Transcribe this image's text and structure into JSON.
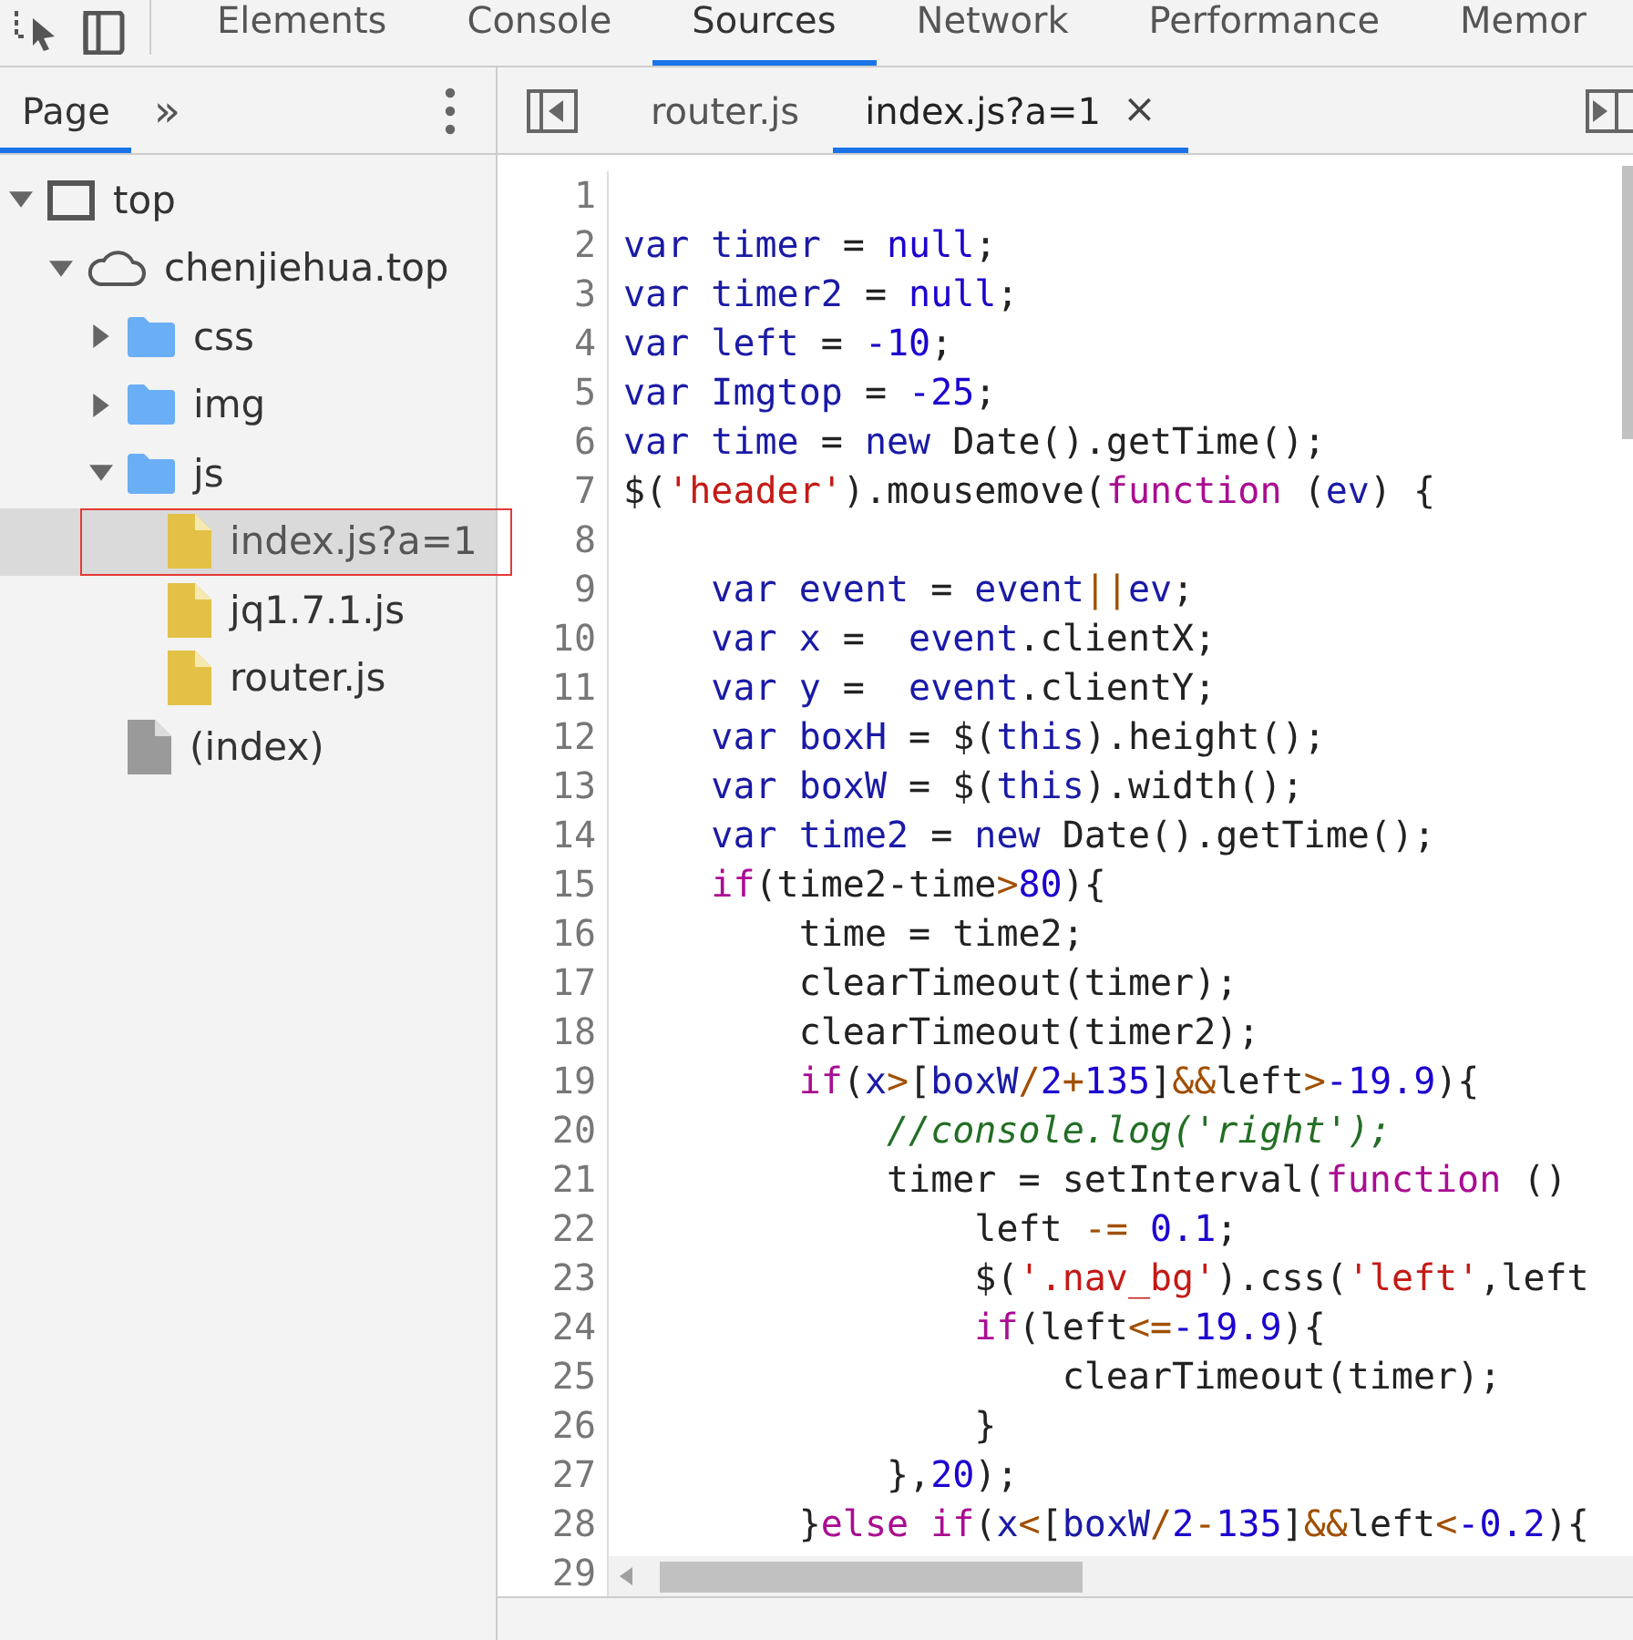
{
  "main_tabs": [
    {
      "label": "Elements",
      "selected": false
    },
    {
      "label": "Console",
      "selected": false
    },
    {
      "label": "Sources",
      "selected": true
    },
    {
      "label": "Network",
      "selected": false
    },
    {
      "label": "Performance",
      "selected": false
    },
    {
      "label": "Memor",
      "selected": false
    }
  ],
  "navigator": {
    "tabs": [
      {
        "label": "Page",
        "selected": true
      }
    ],
    "more": "»"
  },
  "tree": [
    {
      "label": "top",
      "kind": "frame",
      "expanded": true,
      "selected": false,
      "children": [
        {
          "label": "chenjiehua.top",
          "kind": "cloud",
          "expanded": true,
          "selected": false,
          "children": [
            {
              "label": "css",
              "kind": "folder",
              "expanded": false,
              "selected": false
            },
            {
              "label": "img",
              "kind": "folder",
              "expanded": false,
              "selected": false
            },
            {
              "label": "js",
              "kind": "folder",
              "expanded": true,
              "selected": false,
              "children": [
                {
                  "label": "index.js?a=1",
                  "kind": "script",
                  "selected": true,
                  "annotated": true
                },
                {
                  "label": "jq1.7.1.js",
                  "kind": "script",
                  "selected": false,
                  "annotated": false
                },
                {
                  "label": "router.js",
                  "kind": "script",
                  "selected": false,
                  "annotated": false
                }
              ]
            },
            {
              "label": "(index)",
              "kind": "document",
              "selected": false
            }
          ]
        }
      ]
    }
  ],
  "editor_tabs": [
    {
      "label": "router.js",
      "selected": false,
      "closable": false
    },
    {
      "label": "index.js?a=1",
      "selected": true,
      "closable": true,
      "close": "×"
    }
  ],
  "code": [
    {
      "n": "1"
    },
    {
      "n": "2",
      "t": [
        {
          "kind": "kw",
          "text": "var "
        },
        {
          "kind": "def",
          "text": "timer"
        },
        {
          "kind": "pl",
          "text": " = "
        },
        {
          "kind": "num",
          "text": "null"
        },
        {
          "kind": "pl",
          "text": ";"
        }
      ]
    },
    {
      "n": "3",
      "t": [
        {
          "kind": "kw",
          "text": "var "
        },
        {
          "kind": "def",
          "text": "timer2"
        },
        {
          "kind": "pl",
          "text": " = "
        },
        {
          "kind": "num",
          "text": "null"
        },
        {
          "kind": "pl",
          "text": ";"
        }
      ]
    },
    {
      "n": "4",
      "t": [
        {
          "kind": "kw",
          "text": "var "
        },
        {
          "kind": "def",
          "text": "left"
        },
        {
          "kind": "pl",
          "text": " = "
        },
        {
          "kind": "num",
          "text": "-10"
        },
        {
          "kind": "pl",
          "text": ";"
        }
      ]
    },
    {
      "n": "5",
      "t": [
        {
          "kind": "kw",
          "text": "var "
        },
        {
          "kind": "def",
          "text": "Imgtop"
        },
        {
          "kind": "pl",
          "text": " = "
        },
        {
          "kind": "num",
          "text": "-25"
        },
        {
          "kind": "pl",
          "text": ";"
        }
      ]
    },
    {
      "n": "6",
      "t": [
        {
          "kind": "kw",
          "text": "var "
        },
        {
          "kind": "def",
          "text": "time"
        },
        {
          "kind": "pl",
          "text": " = "
        },
        {
          "kind": "kw",
          "text": "new"
        },
        {
          "kind": "pl",
          "text": " Date().getTime();"
        }
      ]
    },
    {
      "n": "7",
      "t": [
        {
          "kind": "pl",
          "text": "$("
        },
        {
          "kind": "str",
          "text": "'header'"
        },
        {
          "kind": "pl",
          "text": ").mousemove("
        },
        {
          "kind": "kw2",
          "text": "function"
        },
        {
          "kind": "pl",
          "text": " ("
        },
        {
          "kind": "def",
          "text": "ev"
        },
        {
          "kind": "pl",
          "text": ") {"
        }
      ]
    },
    {
      "n": "8"
    },
    {
      "n": "9",
      "t": [
        {
          "kind": "kw",
          "text": "    var "
        },
        {
          "kind": "def",
          "text": "event"
        },
        {
          "kind": "pl",
          "text": " = "
        },
        {
          "kind": "def",
          "text": "event"
        },
        {
          "kind": "op",
          "text": "||"
        },
        {
          "kind": "def",
          "text": "ev"
        },
        {
          "kind": "pl",
          "text": ";"
        }
      ]
    },
    {
      "n": "10",
      "t": [
        {
          "kind": "kw",
          "text": "    var "
        },
        {
          "kind": "def",
          "text": "x"
        },
        {
          "kind": "pl",
          "text": " =  "
        },
        {
          "kind": "def",
          "text": "event"
        },
        {
          "kind": "pl",
          "text": ".clientX;"
        }
      ]
    },
    {
      "n": "11",
      "t": [
        {
          "kind": "kw",
          "text": "    var "
        },
        {
          "kind": "def",
          "text": "y"
        },
        {
          "kind": "pl",
          "text": " =  "
        },
        {
          "kind": "def",
          "text": "event"
        },
        {
          "kind": "pl",
          "text": ".clientY;"
        }
      ]
    },
    {
      "n": "12",
      "t": [
        {
          "kind": "kw",
          "text": "    var "
        },
        {
          "kind": "def",
          "text": "boxH"
        },
        {
          "kind": "pl",
          "text": " = $("
        },
        {
          "kind": "kw",
          "text": "this"
        },
        {
          "kind": "pl",
          "text": ").height();"
        }
      ]
    },
    {
      "n": "13",
      "t": [
        {
          "kind": "kw",
          "text": "    var "
        },
        {
          "kind": "def",
          "text": "boxW"
        },
        {
          "kind": "pl",
          "text": " = $("
        },
        {
          "kind": "kw",
          "text": "this"
        },
        {
          "kind": "pl",
          "text": ").width();"
        }
      ]
    },
    {
      "n": "14",
      "t": [
        {
          "kind": "kw",
          "text": "    var "
        },
        {
          "kind": "def",
          "text": "time2"
        },
        {
          "kind": "pl",
          "text": " = "
        },
        {
          "kind": "kw",
          "text": "new"
        },
        {
          "kind": "pl",
          "text": " Date().getTime();"
        }
      ]
    },
    {
      "n": "15",
      "t": [
        {
          "kind": "kw2",
          "text": "    if"
        },
        {
          "kind": "pl",
          "text": "(time2-time"
        },
        {
          "kind": "op",
          "text": ">"
        },
        {
          "kind": "num",
          "text": "80"
        },
        {
          "kind": "pl",
          "text": "){"
        }
      ]
    },
    {
      "n": "16",
      "t": [
        {
          "kind": "pl",
          "text": "        time = time2;"
        }
      ]
    },
    {
      "n": "17",
      "t": [
        {
          "kind": "pl",
          "text": "        clearTimeout(timer);"
        }
      ]
    },
    {
      "n": "18",
      "t": [
        {
          "kind": "pl",
          "text": "        clearTimeout(timer2);"
        }
      ]
    },
    {
      "n": "19",
      "t": [
        {
          "kind": "kw2",
          "text": "        if"
        },
        {
          "kind": "pl",
          "text": "("
        },
        {
          "kind": "def",
          "text": "x"
        },
        {
          "kind": "op",
          "text": ">"
        },
        {
          "kind": "pl",
          "text": "["
        },
        {
          "kind": "def",
          "text": "boxW"
        },
        {
          "kind": "op",
          "text": "/"
        },
        {
          "kind": "num",
          "text": "2"
        },
        {
          "kind": "op",
          "text": "+"
        },
        {
          "kind": "num",
          "text": "135"
        },
        {
          "kind": "pl",
          "text": "]"
        },
        {
          "kind": "op",
          "text": "&&"
        },
        {
          "kind": "pl",
          "text": "left"
        },
        {
          "kind": "op",
          "text": ">"
        },
        {
          "kind": "num",
          "text": "-19.9"
        },
        {
          "kind": "pl",
          "text": "){"
        }
      ]
    },
    {
      "n": "20",
      "t": [
        {
          "kind": "com",
          "text": "            //console.log('right');"
        }
      ]
    },
    {
      "n": "21",
      "t": [
        {
          "kind": "pl",
          "text": "            timer = setInterval("
        },
        {
          "kind": "kw2",
          "text": "function"
        },
        {
          "kind": "pl",
          "text": " ()"
        }
      ]
    },
    {
      "n": "22",
      "t": [
        {
          "kind": "pl",
          "text": "                left "
        },
        {
          "kind": "op",
          "text": "-="
        },
        {
          "kind": "num",
          "text": " 0.1"
        },
        {
          "kind": "pl",
          "text": ";"
        }
      ]
    },
    {
      "n": "23",
      "t": [
        {
          "kind": "pl",
          "text": "                $("
        },
        {
          "kind": "str",
          "text": "'.nav_bg'"
        },
        {
          "kind": "pl",
          "text": ").css("
        },
        {
          "kind": "str",
          "text": "'left'"
        },
        {
          "kind": "pl",
          "text": ",left"
        }
      ]
    },
    {
      "n": "24",
      "t": [
        {
          "kind": "kw2",
          "text": "                if"
        },
        {
          "kind": "pl",
          "text": "(left"
        },
        {
          "kind": "op",
          "text": "<="
        },
        {
          "kind": "num",
          "text": "-19.9"
        },
        {
          "kind": "pl",
          "text": "){"
        }
      ]
    },
    {
      "n": "25",
      "t": [
        {
          "kind": "pl",
          "text": "                    clearTimeout(timer);"
        }
      ]
    },
    {
      "n": "26",
      "t": [
        {
          "kind": "pl",
          "text": "                }"
        }
      ]
    },
    {
      "n": "27",
      "t": [
        {
          "kind": "pl",
          "text": "            },"
        },
        {
          "kind": "num",
          "text": "20"
        },
        {
          "kind": "pl",
          "text": ");"
        }
      ]
    },
    {
      "n": "28",
      "t": [
        {
          "kind": "pl",
          "text": "        }"
        },
        {
          "kind": "kw2",
          "text": "else"
        },
        {
          "kind": "kw2",
          "text": " if"
        },
        {
          "kind": "pl",
          "text": "("
        },
        {
          "kind": "def",
          "text": "x"
        },
        {
          "kind": "op",
          "text": "<"
        },
        {
          "kind": "pl",
          "text": "["
        },
        {
          "kind": "def",
          "text": "boxW"
        },
        {
          "kind": "op",
          "text": "/"
        },
        {
          "kind": "num",
          "text": "2"
        },
        {
          "kind": "op",
          "text": "-"
        },
        {
          "kind": "num",
          "text": "135"
        },
        {
          "kind": "pl",
          "text": "]"
        },
        {
          "kind": "op",
          "text": "&&"
        },
        {
          "kind": "pl",
          "text": "left"
        },
        {
          "kind": "op",
          "text": "<"
        },
        {
          "kind": "num",
          "text": "-0.2"
        },
        {
          "kind": "pl",
          "text": "){"
        }
      ]
    },
    {
      "n": "29"
    }
  ]
}
